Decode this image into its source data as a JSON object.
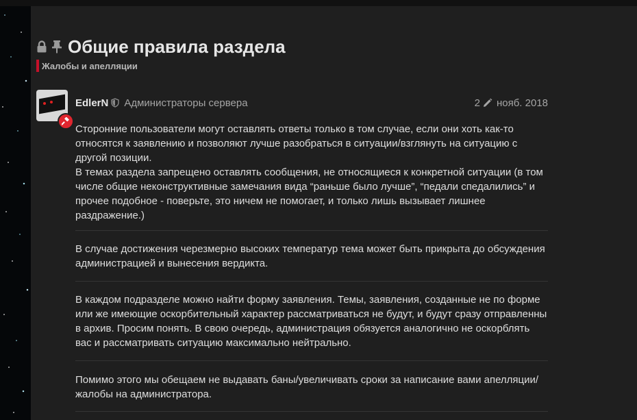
{
  "page": {
    "title": "Общие правила раздела",
    "category": "Жалобы и апелляции",
    "icons": [
      "lock-icon",
      "pin-icon"
    ]
  },
  "post": {
    "username": "EdlerN",
    "group": "Администраторы сервера",
    "edit_count": "2",
    "date": "нояб. 2018",
    "paragraphs": [
      "Сторонние пользователи могут оставлять ответы только в том случае, если они хоть как-то относятся к заявлению и позволяют лучше разобраться в ситуации/взглянуть на ситуацию с другой позиции.",
      "В темах раздела запрещено оставлять сообщения, не относящиеся к конкретной ситуации (в том числе общие неконструктивные замечания вида “раньше было лучше”, “педали спедалились” и прочее подобное - поверьте, это ничем не помогает, и только лишь вызывает лишнее раздражение.)",
      "В случае достижения черезмерно высоких температур тема может быть прикрыта до обсуждения администрацией и вынесения вердикта.",
      "В каждом подразделе можно найти форму заявления. Темы, заявления, созданные не по форме или же имеющие оскорбительный характер рассматриваться не будут, и будут сразу отправленны в архив. Просим понять. В свою очередь, администрация обязуется аналогично не оскорблять вас и рассматривать ситуацию максимально нейтрально.",
      "Помимо этого мы обещаем не выдавать баны/увеличивать сроки за написание вами апелляции/жалобы на администратора."
    ]
  },
  "colors": {
    "background": "#1f1f1f",
    "category_accent": "#c6112a",
    "badge": "#e0262f",
    "text": "#dedede",
    "muted": "#a5a5a5"
  }
}
